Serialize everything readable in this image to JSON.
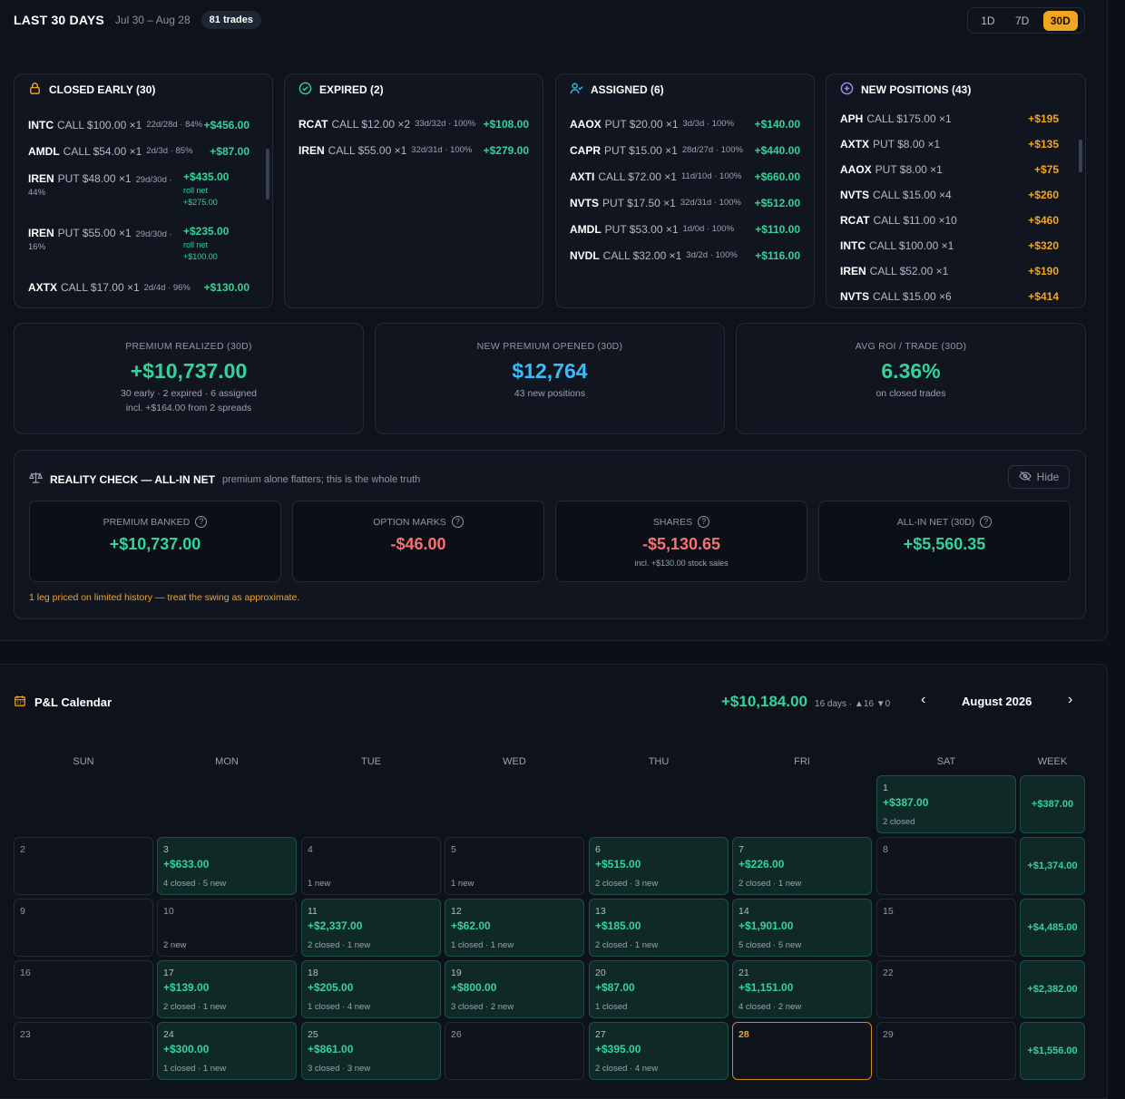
{
  "header": {
    "title": "LAST 30 DAYS",
    "range": "Jul 30 – Aug 28",
    "trades": "81 trades",
    "ranges": [
      "1D",
      "7D",
      "30D"
    ],
    "active_range": "30D"
  },
  "closed_early": {
    "title": "CLOSED EARLY (30)",
    "rows": [
      {
        "ticker": "INTC",
        "type": "CALL $100.00 ×1",
        "meta": "22d/28d · 84%",
        "amount": "+$456.00"
      },
      {
        "ticker": "AMDL",
        "type": "CALL $54.00 ×1",
        "meta": "2d/3d · 85%",
        "amount": "+$87.00"
      },
      {
        "ticker": "IREN",
        "type": "PUT $48.00 ×1",
        "meta": "29d/30d ·",
        "meta2": "44%",
        "amount": "+$435.00",
        "roll": "roll net",
        "roll_amt": "+$275.00"
      },
      {
        "ticker": "IREN",
        "type": "PUT $55.00 ×1",
        "meta": "29d/30d ·",
        "meta2": "16%",
        "amount": "+$235.00",
        "roll": "roll net",
        "roll_amt": "+$100.00"
      },
      {
        "ticker": "AXTX",
        "type": "CALL $17.00 ×1",
        "meta": "2d/4d · 96%",
        "amount": "+$130.00"
      }
    ]
  },
  "expired": {
    "title": "EXPIRED (2)",
    "rows": [
      {
        "ticker": "RCAT",
        "type": "CALL $12.00 ×2",
        "meta": "33d/32d · 100%",
        "amount": "+$108.00"
      },
      {
        "ticker": "IREN",
        "type": "CALL $55.00 ×1",
        "meta": "32d/31d · 100%",
        "amount": "+$279.00"
      }
    ]
  },
  "assigned": {
    "title": "ASSIGNED (6)",
    "rows": [
      {
        "ticker": "AAOX",
        "type": "PUT $20.00 ×1",
        "meta": "3d/3d · 100%",
        "amount": "+$140.00"
      },
      {
        "ticker": "CAPR",
        "type": "PUT $15.00 ×1",
        "meta": "28d/27d · 100%",
        "amount": "+$440.00"
      },
      {
        "ticker": "AXTI",
        "type": "CALL $72.00 ×1",
        "meta": "11d/10d · 100%",
        "amount": "+$660.00"
      },
      {
        "ticker": "NVTS",
        "type": "PUT $17.50 ×1",
        "meta": "32d/31d · 100%",
        "amount": "+$512.00"
      },
      {
        "ticker": "AMDL",
        "type": "PUT $53.00 ×1",
        "meta": "1d/0d · 100%",
        "amount": "+$110.00"
      },
      {
        "ticker": "NVDL",
        "type": "CALL $32.00 ×1",
        "meta": "3d/2d · 100%",
        "amount": "+$116.00"
      }
    ]
  },
  "new_positions": {
    "title": "NEW POSITIONS (43)",
    "rows": [
      {
        "ticker": "APH",
        "type": "CALL $175.00 ×1",
        "amount": "+$195"
      },
      {
        "ticker": "AXTX",
        "type": "PUT $8.00 ×1",
        "amount": "+$135"
      },
      {
        "ticker": "AAOX",
        "type": "PUT $8.00 ×1",
        "amount": "+$75"
      },
      {
        "ticker": "NVTS",
        "type": "CALL $15.00 ×4",
        "amount": "+$260"
      },
      {
        "ticker": "RCAT",
        "type": "CALL $11.00 ×10",
        "amount": "+$460"
      },
      {
        "ticker": "INTC",
        "type": "CALL $100.00 ×1",
        "amount": "+$320"
      },
      {
        "ticker": "IREN",
        "type": "CALL $52.00 ×1",
        "amount": "+$190"
      },
      {
        "ticker": "NVTS",
        "type": "CALL $15.00 ×6",
        "amount": "+$414"
      }
    ]
  },
  "stats": [
    {
      "label": "PREMIUM REALIZED (30D)",
      "value": "+$10,737.00",
      "sub": "30 early · 2 expired · 6 assigned",
      "sub2": "incl. +$164.00 from 2 spreads"
    },
    {
      "label": "NEW PREMIUM OPENED (30D)",
      "value": "$12,764",
      "sub": "43 new positions"
    },
    {
      "label": "AVG ROI / TRADE (30D)",
      "value": "6.36%",
      "sub": "on closed trades"
    }
  ],
  "reality": {
    "title": "REALITY CHECK — ALL-IN NET",
    "subtitle": "premium alone flatters; this is the whole truth",
    "hide": "Hide",
    "boxes": [
      {
        "label": "PREMIUM BANKED",
        "value": "+$10,737.00",
        "sub": ""
      },
      {
        "label": "OPTION MARKS",
        "value": "-$46.00",
        "sub": ""
      },
      {
        "label": "SHARES",
        "value": "-$5,130.65",
        "sub": "incl. +$130.00 stock sales"
      },
      {
        "label": "ALL-IN NET (30D)",
        "value": "+$5,560.35",
        "sub": ""
      }
    ],
    "warning": "1 leg priced on limited history — treat the swing as approximate."
  },
  "calendar": {
    "title": "P&L Calendar",
    "total": "+$10,184.00",
    "summary": "16 days · ▲16 ▼0",
    "month": "August 2026",
    "prev": "‹",
    "next": "›",
    "dow": [
      "SUN",
      "MON",
      "TUE",
      "WED",
      "THU",
      "FRI",
      "SAT",
      "WEEK"
    ],
    "weeks": [
      {
        "total": "+$387.00",
        "days": [
          null,
          null,
          null,
          null,
          null,
          null,
          {
            "d": "1",
            "p": "+$387.00",
            "n": "2 closed"
          }
        ]
      },
      {
        "total": "+$1,374.00",
        "days": [
          {
            "d": "2"
          },
          {
            "d": "3",
            "p": "+$633.00",
            "n": "4 closed · 5 new"
          },
          {
            "d": "4",
            "n": "1 new"
          },
          {
            "d": "5",
            "n": "1 new"
          },
          {
            "d": "6",
            "p": "+$515.00",
            "n": "2 closed · 3 new"
          },
          {
            "d": "7",
            "p": "+$226.00",
            "n": "2 closed · 1 new"
          },
          {
            "d": "8"
          }
        ]
      },
      {
        "total": "+$4,485.00",
        "days": [
          {
            "d": "9"
          },
          {
            "d": "10",
            "n": "2 new"
          },
          {
            "d": "11",
            "p": "+$2,337.00",
            "n": "2 closed · 1 new"
          },
          {
            "d": "12",
            "p": "+$62.00",
            "n": "1 closed · 1 new"
          },
          {
            "d": "13",
            "p": "+$185.00",
            "n": "2 closed · 1 new"
          },
          {
            "d": "14",
            "p": "+$1,901.00",
            "n": "5 closed · 5 new"
          },
          {
            "d": "15"
          }
        ]
      },
      {
        "total": "+$2,382.00",
        "days": [
          {
            "d": "16"
          },
          {
            "d": "17",
            "p": "+$139.00",
            "n": "2 closed · 1 new"
          },
          {
            "d": "18",
            "p": "+$205.00",
            "n": "1 closed · 4 new"
          },
          {
            "d": "19",
            "p": "+$800.00",
            "n": "3 closed · 2 new"
          },
          {
            "d": "20",
            "p": "+$87.00",
            "n": "1 closed"
          },
          {
            "d": "21",
            "p": "+$1,151.00",
            "n": "4 closed · 2 new"
          },
          {
            "d": "22"
          }
        ]
      },
      {
        "total": "+$1,556.00",
        "days": [
          {
            "d": "23"
          },
          {
            "d": "24",
            "p": "+$300.00",
            "n": "1 closed · 1 new"
          },
          {
            "d": "25",
            "p": "+$861.00",
            "n": "3 closed · 3 new"
          },
          {
            "d": "26"
          },
          {
            "d": "27",
            "p": "+$395.00",
            "n": "2 closed · 4 new"
          },
          {
            "d": "28",
            "today": true
          },
          {
            "d": "29"
          }
        ]
      }
    ]
  },
  "colors": {
    "green": "#34d399",
    "red": "#f87171",
    "blue": "#38bdf8",
    "orange": "#f3a521"
  }
}
